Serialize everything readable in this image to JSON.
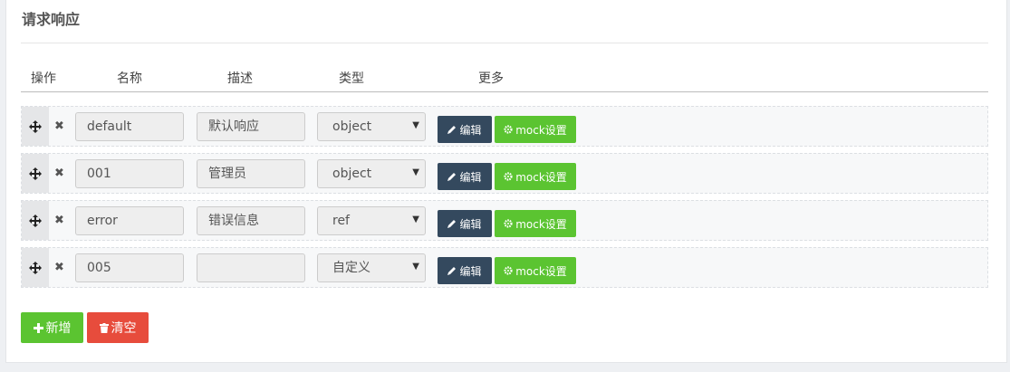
{
  "section": {
    "title": "请求响应"
  },
  "table": {
    "headers": {
      "action": "操作",
      "name": "名称",
      "desc": "描述",
      "type": "类型",
      "more": "更多"
    }
  },
  "rows": [
    {
      "name": "default",
      "desc": "默认响应",
      "type": "object"
    },
    {
      "name": "001",
      "desc": "管理员",
      "type": "object"
    },
    {
      "name": "error",
      "desc": "错误信息",
      "type": "ref"
    },
    {
      "name": "005",
      "desc": "",
      "type": "自定义"
    }
  ],
  "row_buttons": {
    "edit": "编辑",
    "mock": "mock设置"
  },
  "footer": {
    "add": "新增",
    "clear": "清空"
  },
  "colors": {
    "dark": "#34495e",
    "green": "#5bc431",
    "red": "#e74c3c"
  },
  "icons": {
    "move": "arrows-move-icon",
    "remove": "close-icon",
    "edit": "pencil-icon",
    "mock": "gear-icon",
    "add": "plus-icon",
    "clear": "trash-icon"
  }
}
